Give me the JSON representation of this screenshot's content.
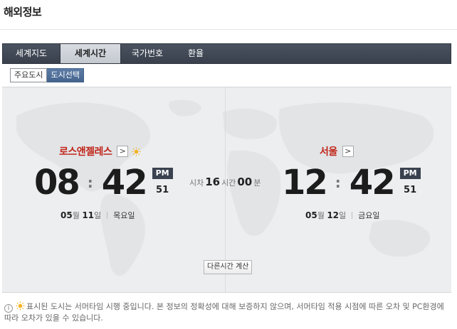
{
  "page": {
    "title": "해외정보"
  },
  "tabs": [
    {
      "label": "세계지도"
    },
    {
      "label": "세계시간"
    },
    {
      "label": "국가번호"
    },
    {
      "label": "환율"
    }
  ],
  "subtabs": [
    {
      "label": "주요도시"
    },
    {
      "label": "도시선택"
    }
  ],
  "left_city": {
    "name": "로스앤젤레스",
    "hour": "08",
    "minute": "42",
    "ampm": "PM",
    "seconds": "51",
    "month": "05",
    "month_unit": "월",
    "day": "11",
    "day_unit": "일",
    "weekday": "목요일",
    "dst": true
  },
  "right_city": {
    "name": "서울",
    "hour": "12",
    "minute": "42",
    "ampm": "PM",
    "seconds": "51",
    "month": "05",
    "month_unit": "월",
    "day": "12",
    "day_unit": "일",
    "weekday": "금요일"
  },
  "difference": {
    "prefix": "시차",
    "hours": "16",
    "hours_unit": "시간",
    "minutes": "00",
    "minutes_unit": "분"
  },
  "colon": ":",
  "arrow": ">",
  "calc_button": "다른시간 계산",
  "notice": {
    "info_glyph": "i",
    "text": "표시된 도시는 서머타임 시행 중입니다. 본 정보의 정확성에 대해 보증하지 않으며, 서머타임 적용 시점에 따른 오차 및 PC환경에 따라 오차가 있을 수 있습니다."
  },
  "colors": {
    "accent_red": "#c1271b",
    "tab_bar": "#3a414d",
    "sun": "#f5b324"
  }
}
